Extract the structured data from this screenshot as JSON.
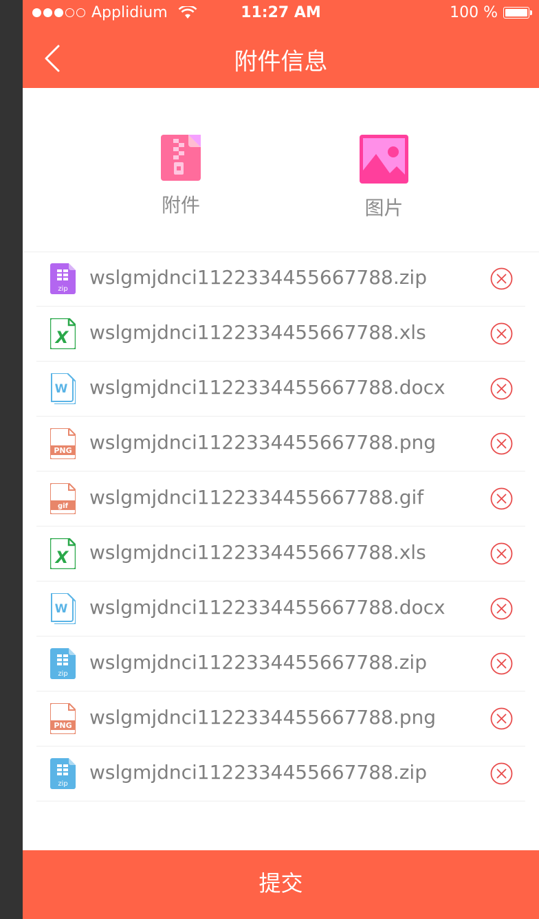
{
  "status_bar": {
    "carrier": "Applidium",
    "time": "11:27 AM",
    "battery": "100 %",
    "signal_icon": "signal-dots-icon",
    "wifi_icon": "wifi-icon",
    "battery_icon": "battery-icon"
  },
  "nav": {
    "title": "附件信息",
    "back_icon": "chevron-left-icon"
  },
  "picker": {
    "attach_label": "附件",
    "attach_icon": "zip-archive-icon",
    "image_label": "图片",
    "image_icon": "picture-icon"
  },
  "files": [
    {
      "name": "wslgmjdnci1122334455667788.zip",
      "type": "zip",
      "color": "#b366f0"
    },
    {
      "name": "wslgmjdnci1122334455667788.xls",
      "type": "xls",
      "color": "#2aa84a"
    },
    {
      "name": "wslgmjdnci1122334455667788.docx",
      "type": "docx",
      "color": "#5ab4e6"
    },
    {
      "name": "wslgmjdnci1122334455667788.png",
      "type": "png",
      "color": "#e8866a"
    },
    {
      "name": "wslgmjdnci1122334455667788.gif",
      "type": "gif",
      "color": "#e8866a"
    },
    {
      "name": "wslgmjdnci1122334455667788.xls",
      "type": "xls",
      "color": "#2aa84a"
    },
    {
      "name": "wslgmjdnci1122334455667788.docx",
      "type": "docx",
      "color": "#5ab4e6"
    },
    {
      "name": "wslgmjdnci1122334455667788.zip",
      "type": "zip",
      "color": "#5ab4e6"
    },
    {
      "name": "wslgmjdnci1122334455667788.png",
      "type": "png",
      "color": "#e8866a"
    },
    {
      "name": "wslgmjdnci1122334455667788.zip",
      "type": "zip",
      "color": "#5ab4e6"
    }
  ],
  "delete_icon": "close-circle-icon",
  "submit_label": "提交",
  "colors": {
    "brand": "#ff6347",
    "label_gray": "#8c8c8c",
    "file_text": "#7f7f7f",
    "delete_red": "#e84c4c",
    "nav_text": "#ffffff"
  }
}
